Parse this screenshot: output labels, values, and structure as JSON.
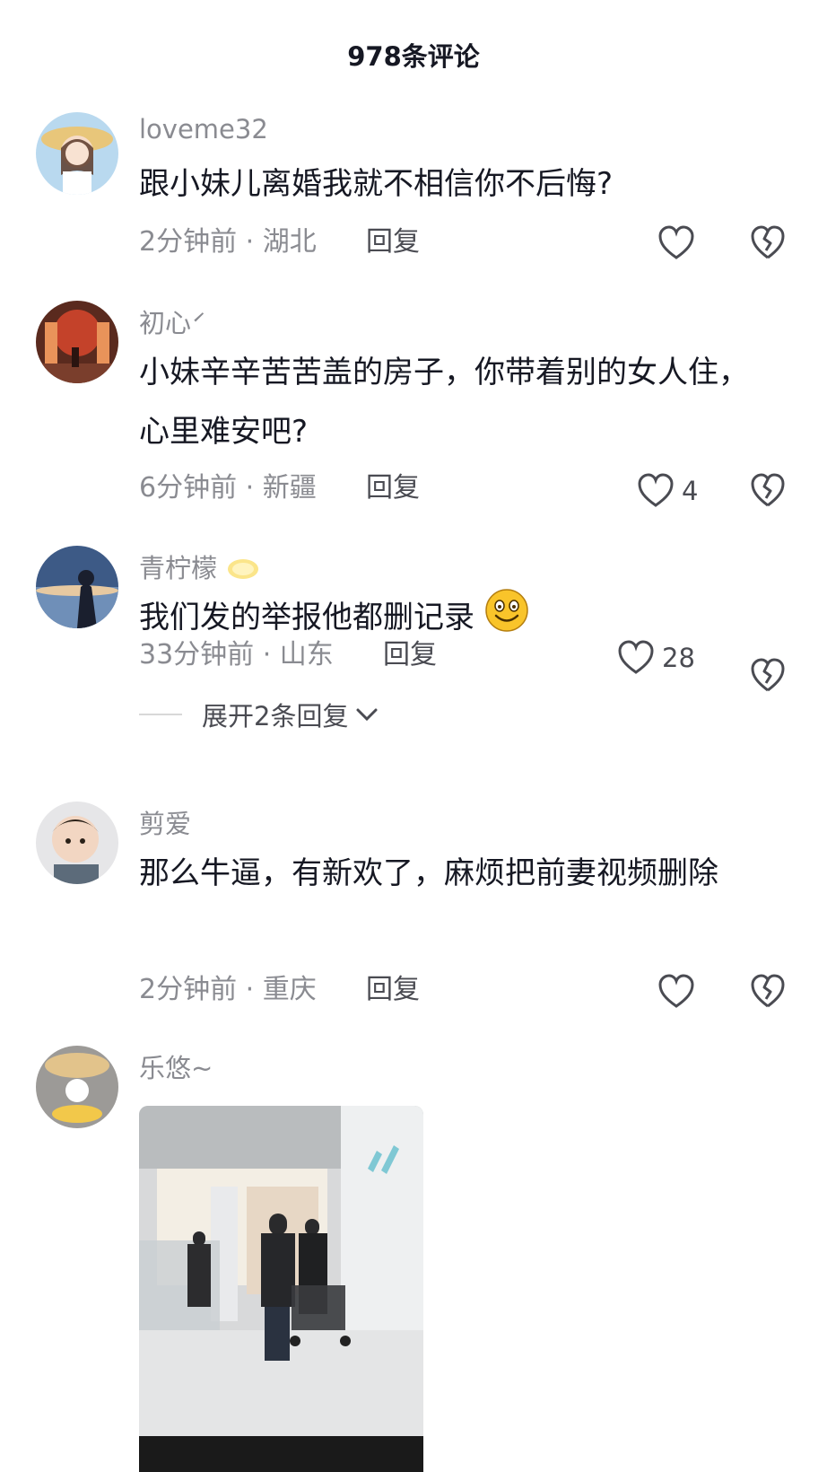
{
  "header": {
    "title": "978条评论"
  },
  "comments": [
    {
      "username": "loveme32",
      "text": "跟小妹儿离婚我就不相信你不后悔?",
      "meta": "2分钟前 · 湖北",
      "reply_label": "回复",
      "likes": ""
    },
    {
      "username": "初心́",
      "text": "小妹辛辛苦苦盖的房子，你带着别的女人住，心里难安吧?",
      "meta": "6分钟前 · 新疆",
      "reply_label": "回复",
      "likes": "4"
    },
    {
      "username": "青柠檬",
      "text": "我们发的举报他都删记录",
      "meta": "33分钟前 · 山东",
      "reply_label": "回复",
      "likes": "28",
      "expand_label": "展开2条回复"
    },
    {
      "username": "剪爱",
      "text": "那么牛逼，有新欢了，麻烦把前妻视频删除",
      "meta": "2分钟前 · 重庆",
      "reply_label": "回复",
      "likes": ""
    },
    {
      "username": "乐悠~",
      "text": "",
      "meta": "",
      "reply_label": "",
      "likes": ""
    }
  ],
  "icons": {
    "like": "heart-outline-icon",
    "dislike": "broken-heart-icon",
    "expand": "chevron-down-icon"
  },
  "colors": {
    "primary_text": "#161823",
    "secondary_text": "#8a8b91",
    "icon": "#4a4b52"
  }
}
